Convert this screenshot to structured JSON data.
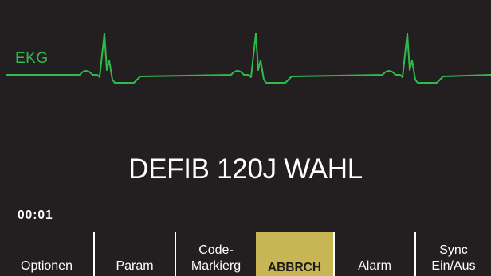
{
  "waveform": {
    "label": "EKG",
    "color": "#2fb84c"
  },
  "status_message": "DEFIB 120J WAHL",
  "timer": "00:01",
  "softkeys": [
    {
      "line1": "",
      "line2": "Optionen",
      "active": false
    },
    {
      "line1": "",
      "line2": "Param",
      "active": false
    },
    {
      "line1": "Code-",
      "line2": "Markierg",
      "active": false
    },
    {
      "line1": "",
      "line2": "ABBRCH",
      "active": true
    },
    {
      "line1": "",
      "line2": "Alarm",
      "active": false
    },
    {
      "line1": "Sync",
      "line2": "Ein/Aus",
      "active": false
    }
  ],
  "colors": {
    "background": "#231f20",
    "text": "#ffffff",
    "active_softkey": "#c8b654"
  }
}
